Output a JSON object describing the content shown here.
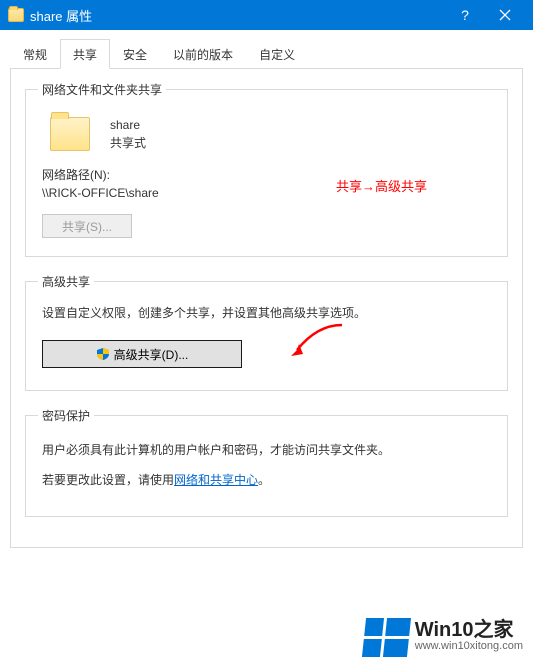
{
  "titlebar": {
    "title": "share 属性",
    "help_symbol": "?",
    "close_label": "✕"
  },
  "tabs": {
    "items": [
      {
        "label": "常规"
      },
      {
        "label": "共享"
      },
      {
        "label": "安全"
      },
      {
        "label": "以前的版本"
      },
      {
        "label": "自定义"
      }
    ],
    "active_index": 1
  },
  "group_network": {
    "legend": "网络文件和文件夹共享",
    "folder_name": "share",
    "share_state": "共享式",
    "path_label": "网络路径(N):",
    "path_value": "\\\\RICK-OFFICE\\share",
    "share_button": "共享(S)...",
    "annotation": "共享→高级共享"
  },
  "group_advanced": {
    "legend": "高级共享",
    "description": "设置自定义权限，创建多个共享，并设置其他高级共享选项。",
    "button_label": "高级共享(D)..."
  },
  "group_password": {
    "legend": "密码保护",
    "line1": "用户必须具有此计算机的用户帐户和密码，才能访问共享文件夹。",
    "line2_prefix": "若要更改此设置，请使用",
    "link_text": "网络和共享中心",
    "line2_suffix": "。"
  },
  "watermark": {
    "brand": "Win10之家",
    "url": "www.win10xitong.com"
  }
}
